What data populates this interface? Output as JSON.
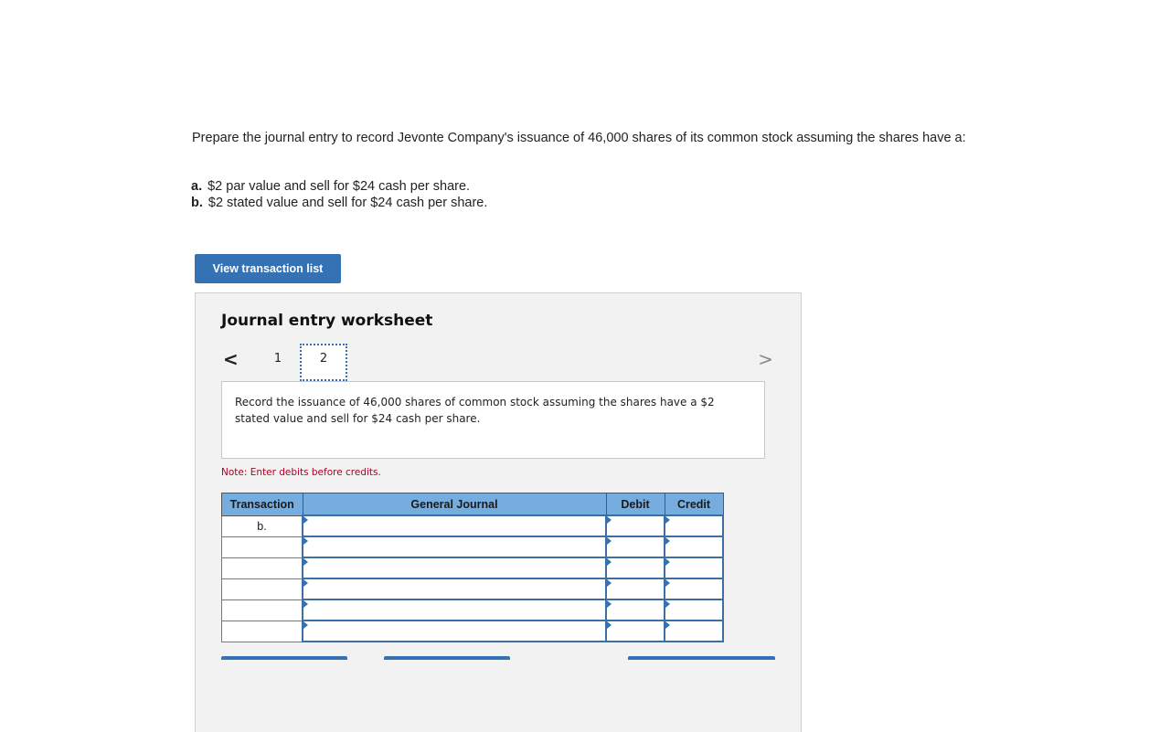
{
  "question": {
    "prompt": "Prepare the journal entry to record Jevonte Company's issuance of 46,000 shares of its common stock assuming the shares have a:",
    "parts": [
      {
        "label": "a.",
        "text": "$2 par value and sell for $24 cash per share."
      },
      {
        "label": "b.",
        "text": "$2 stated value and sell for $24 cash per share."
      }
    ]
  },
  "view_transaction_button": "View transaction list",
  "worksheet": {
    "title": "Journal entry worksheet",
    "nav": {
      "prev_icon": "chevron-left",
      "next_icon": "chevron-right",
      "prev_glyph": "<",
      "next_glyph": ">"
    },
    "tabs": [
      {
        "label": "1",
        "active": false
      },
      {
        "label": "2",
        "active": true
      }
    ],
    "description": "Record the issuance of 46,000 shares of common stock assuming the shares have a $2 stated value and sell for $24 cash per share.",
    "note": "Note: Enter debits before credits.",
    "table": {
      "headers": [
        "Transaction",
        "General Journal",
        "Debit",
        "Credit"
      ],
      "rows": [
        {
          "transaction": "b.",
          "account": "",
          "debit": "",
          "credit": ""
        },
        {
          "transaction": "",
          "account": "",
          "debit": "",
          "credit": ""
        },
        {
          "transaction": "",
          "account": "",
          "debit": "",
          "credit": ""
        },
        {
          "transaction": "",
          "account": "",
          "debit": "",
          "credit": ""
        },
        {
          "transaction": "",
          "account": "",
          "debit": "",
          "credit": ""
        },
        {
          "transaction": "",
          "account": "",
          "debit": "",
          "credit": ""
        }
      ]
    }
  },
  "colors": {
    "accent": "#3472b5",
    "header_bg": "#77acde",
    "note": "#b00020",
    "panel_bg": "#f2f2f2"
  }
}
